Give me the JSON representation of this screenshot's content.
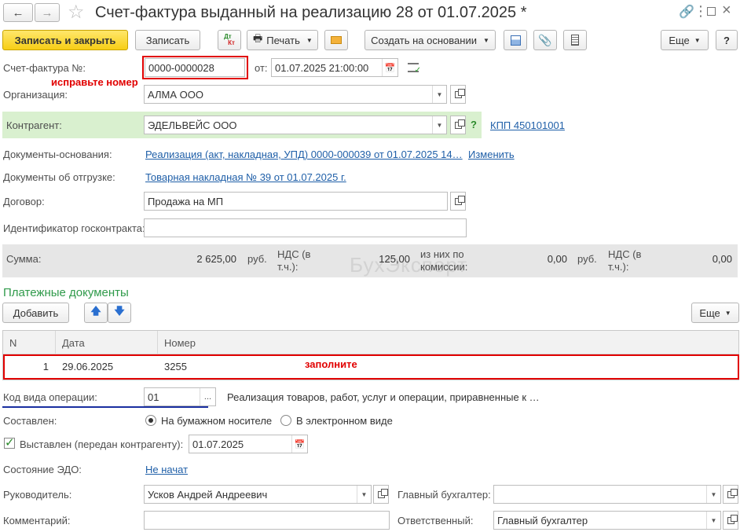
{
  "window": {
    "title": "Счет-фактура выданный на реализацию 28 от 01.07.2025 *"
  },
  "toolbar": {
    "save_close": "Записать и закрыть",
    "save": "Записать",
    "print": "Печать",
    "create_based": "Создать на основании",
    "more": "Еще",
    "help": "?",
    "dtkt_top": "Дт",
    "dtkt_bottom": "Кт"
  },
  "form": {
    "invoice_label": "Счет-фактура №:",
    "invoice_number": "0000-0000028",
    "date_label": "от:",
    "date_value": "01.07.2025 21:00:00",
    "fix_number_note": "исправьте номер",
    "org_label": "Организация:",
    "org_value": "АЛМА ООО",
    "contractor_label": "Контрагент:",
    "contractor_value": "ЭДЕЛЬВЕЙС ООО",
    "contractor_help": "?",
    "kpp_link": "КПП 450101001",
    "base_docs_label": "Документы-основания:",
    "base_docs_link": "Реализация (акт, накладная, УПД) 0000-000039 от 01.07.2025 14…",
    "change_link": "Изменить",
    "ship_docs_label": "Документы об отгрузке:",
    "ship_docs_link": "Товарная накладная № 39 от 01.07.2025 г.",
    "contract_label": "Договор:",
    "contract_value": "Продажа на МП",
    "gov_id_label": "Идентификатор госконтракта:",
    "gov_id_value": ""
  },
  "totals": {
    "sum_label": "Сумма:",
    "sum_value": "2 625,00",
    "currency": "руб.",
    "vat_label": "НДС (в т.ч.):",
    "vat_value": "125,00",
    "commission_label": "из них по комиссии:",
    "commission_value": "0,00",
    "currency2": "руб.",
    "vat2_label": "НДС (в т.ч.):",
    "vat2_value": "0,00",
    "watermark": "БухЭксперт"
  },
  "payments": {
    "section_title": "Платежные документы",
    "add_button": "Добавить",
    "more_button": "Еще",
    "columns": [
      "N",
      "Дата",
      "Номер"
    ],
    "rows": [
      {
        "n": "1",
        "date": "29.06.2025",
        "number": "3255"
      }
    ],
    "fill_note": "заполните"
  },
  "operation": {
    "code_label": "Код вида операции:",
    "code_value": "01",
    "code_description": "Реализация товаров, работ, услуг и операции, приравненные к …",
    "picker": "..."
  },
  "composed": {
    "label": "Составлен:",
    "option_paper": "На бумажном носителе",
    "option_electronic": "В электронном виде",
    "selected": "paper"
  },
  "issued": {
    "label": "Выставлен (передан контрагенту):",
    "checked": true,
    "date": "01.07.2025"
  },
  "edo": {
    "label": "Состояние ЭДО:",
    "status_link": "Не начат"
  },
  "people": {
    "manager_label": "Руководитель:",
    "manager_value": "Усков Андрей Андреевич",
    "chief_accountant_label": "Главный бухгалтер:",
    "chief_accountant_value": "",
    "comment_label": "Комментарий:",
    "comment_value": "",
    "responsible_label": "Ответственный:",
    "responsible_value": "Главный бухгалтер"
  },
  "colors": {
    "primary_button": "#f7ce16",
    "highlight_red": "#e10000",
    "link_blue": "#1f5fa8",
    "section_green": "#2f9a4a",
    "contractor_bg": "#d9f0cf",
    "totals_bg": "#e6e6e6",
    "underline_blue": "#1a2fa0"
  },
  "icons": [
    "back-arrow-icon",
    "forward-arrow-icon",
    "star-icon",
    "link-icon",
    "kebab-menu-icon",
    "maximize-icon",
    "close-icon",
    "printer-icon",
    "envelope-icon",
    "structure-icon",
    "paperclip-icon",
    "list-icon",
    "calendar-icon",
    "arrow-up-icon",
    "arrow-down-icon",
    "checkmark-icon"
  ]
}
